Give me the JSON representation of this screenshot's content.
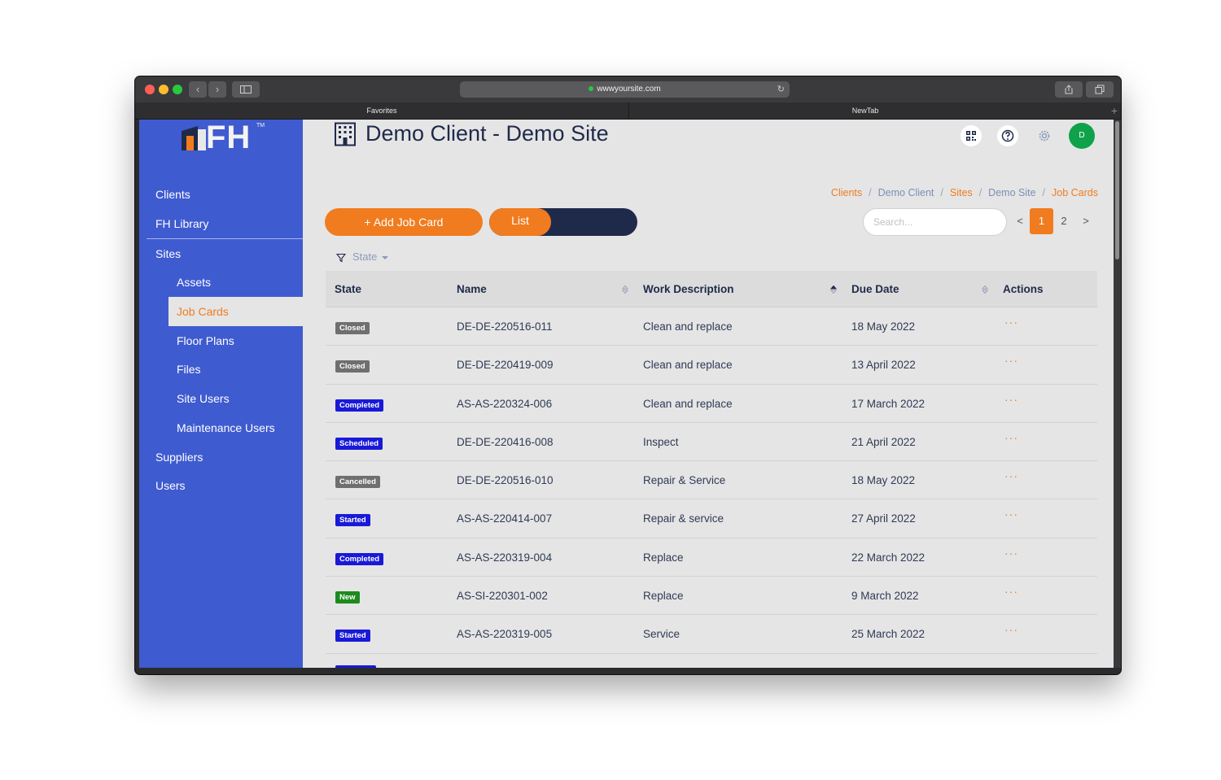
{
  "browser": {
    "url": "wwwyoursite.com",
    "tabs": [
      "Favorites",
      "NewTab"
    ]
  },
  "app": {
    "logo_text": "FH",
    "logo_tm": "TM",
    "page_title": "Demo Client - Demo Site",
    "avatar_initial": "D"
  },
  "sidebar": {
    "items": [
      {
        "label": "Clients"
      },
      {
        "label": "FH Library"
      },
      {
        "label": "Sites"
      },
      {
        "label": "Assets"
      },
      {
        "label": "Job Cards"
      },
      {
        "label": "Floor Plans"
      },
      {
        "label": "Files"
      },
      {
        "label": "Site Users"
      },
      {
        "label": "Maintenance Users"
      },
      {
        "label": "Suppliers"
      },
      {
        "label": "Users"
      }
    ],
    "active": "Job Cards"
  },
  "breadcrumb": [
    "Clients",
    "Demo Client",
    "Sites",
    "Demo Site",
    "Job Cards"
  ],
  "toolbar": {
    "add_label": "+ Add Job Card",
    "view_toggle": "List",
    "search_placeholder": "Search...",
    "pagination": {
      "prev": "<",
      "pages": [
        "1",
        "2"
      ],
      "current": "1",
      "next": ">"
    }
  },
  "filter": {
    "label": "State"
  },
  "table": {
    "columns": [
      "State",
      "Name",
      "Work Description",
      "Due Date",
      "Actions"
    ],
    "rows": [
      {
        "state": "Closed",
        "name": "DE-DE-220516-011",
        "work": "Clean and replace",
        "due": "18 May 2022",
        "actions": "···"
      },
      {
        "state": "Closed",
        "name": "DE-DE-220419-009",
        "work": "Clean and replace",
        "due": "13 April 2022",
        "actions": "···"
      },
      {
        "state": "Completed",
        "name": "AS-AS-220324-006",
        "work": "Clean and replace",
        "due": "17 March 2022",
        "actions": "···"
      },
      {
        "state": "Scheduled",
        "name": "DE-DE-220416-008",
        "work": "Inspect",
        "due": "21 April 2022",
        "actions": "···"
      },
      {
        "state": "Cancelled",
        "name": "DE-DE-220516-010",
        "work": "Repair & Service",
        "due": "18 May 2022",
        "actions": "···"
      },
      {
        "state": "Started",
        "name": "AS-AS-220414-007",
        "work": "Repair & service",
        "due": "27 April 2022",
        "actions": "···"
      },
      {
        "state": "Completed",
        "name": "AS-AS-220319-004",
        "work": "Replace",
        "due": "22 March 2022",
        "actions": "···"
      },
      {
        "state": "New",
        "name": "AS-SI-220301-002",
        "work": "Replace",
        "due": "9 March 2022",
        "actions": "···"
      },
      {
        "state": "Started",
        "name": "AS-AS-220319-005",
        "work": "Service",
        "due": "25 March 2022",
        "actions": "···"
      }
    ]
  },
  "colors": {
    "sidebar": "#3f5bd0",
    "accent": "#f07c1f",
    "navy": "#1f2a4a",
    "badge_closed": "#6f6f6f",
    "badge_blue": "#1919d8",
    "badge_new": "#1d8a1d",
    "avatar": "#0fa24a"
  }
}
